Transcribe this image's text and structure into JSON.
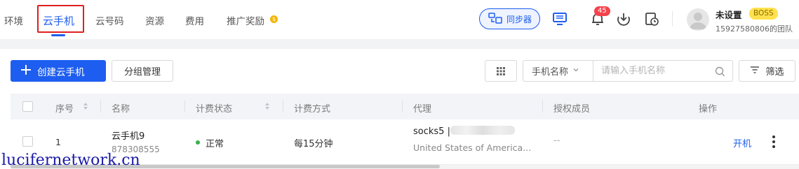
{
  "nav": {
    "tabs": [
      "环境",
      "云手机",
      "云号码",
      "资源",
      "费用",
      "推广奖励"
    ],
    "active_tab": "云手机",
    "sync_label": "同步器",
    "notification_count": "45",
    "user": {
      "name": "未设置",
      "role_badge": "BOSS",
      "team": "15927580806的团队"
    },
    "icons": [
      "sync-devices-icon",
      "remote-screen-icon",
      "bell-icon",
      "download-icon",
      "history-icon",
      "avatar-icon",
      "coin-icon"
    ]
  },
  "toolbar": {
    "create_label": "创建云手机",
    "group_label": "分组管理",
    "filter_field": "手机名称",
    "search_placeholder": "请输入手机名称",
    "filter_label": "筛选"
  },
  "table": {
    "headers": [
      "序号",
      "名称",
      "计费状态",
      "计费方式",
      "代理",
      "授权成员",
      "操作"
    ],
    "rows": [
      {
        "index": "1",
        "name": "云手机9",
        "id": "878308555",
        "status": "正常",
        "billing": "每15分钟",
        "proxy_type": "socks5 |",
        "proxy_location": "United States of America...",
        "members": "--",
        "action": "开机"
      }
    ]
  },
  "colors": {
    "accent": "#1d5ef0",
    "status_ok": "#34b24a",
    "badge": "#f5424b",
    "boss": "#ffe14d"
  },
  "watermark": "lucifernetwork.cn"
}
